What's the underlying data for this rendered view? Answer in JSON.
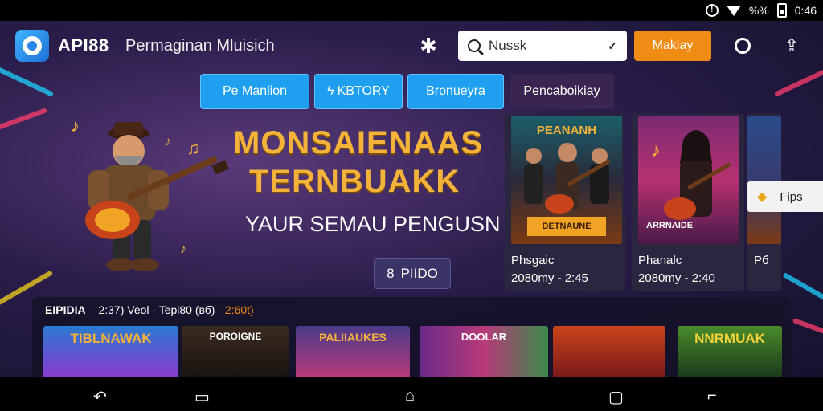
{
  "status_bar": {
    "time": "0:46",
    "signal": "%%"
  },
  "header": {
    "brand": "API88",
    "title": "Permaginan Mluisich",
    "search_value": "Nussk",
    "primary_button": "Makiay"
  },
  "tabs": [
    {
      "label": "Pe Manlion"
    },
    {
      "label": "KBTORY"
    },
    {
      "label": "Bronueyra"
    },
    {
      "label": "Pencaboikiay"
    }
  ],
  "hero": {
    "title_line1": "MONSAIENAAS",
    "title_line2": "TERNBUAKK",
    "subtitle": "YAUR SEMAU PENGUSN",
    "button_label": "PIIDO"
  },
  "featured": [
    {
      "art_label": "PEANANH",
      "poster_label": "DETNAUNE",
      "title": "Phsgaic",
      "meta": "2080my - 2:45"
    },
    {
      "art_label": "",
      "poster_label": "ARRNAIDE",
      "title": "Phanalc",
      "meta": "2080my - 2:40"
    },
    {
      "art_label": "",
      "poster_label": "",
      "title": "Pб",
      "meta": ""
    }
  ],
  "side_chip": {
    "label": "Fips"
  },
  "rail": {
    "heading": "EIPIDIA",
    "info": "2:37) Veol - Tepi80 (вб)",
    "highlight": "- 2:60t)"
  },
  "thumbs": [
    {
      "label": "TIBLNAWAK"
    },
    {
      "label": "POROIGNE"
    },
    {
      "label": "PALIIAUKES"
    },
    {
      "label": "DOOLAR"
    },
    {
      "label": ""
    },
    {
      "label": "NNRMUAK"
    }
  ],
  "colors": {
    "accent_orange": "#f08c14",
    "tab_blue": "#1e9ff0",
    "gold": "#f3b33a"
  }
}
